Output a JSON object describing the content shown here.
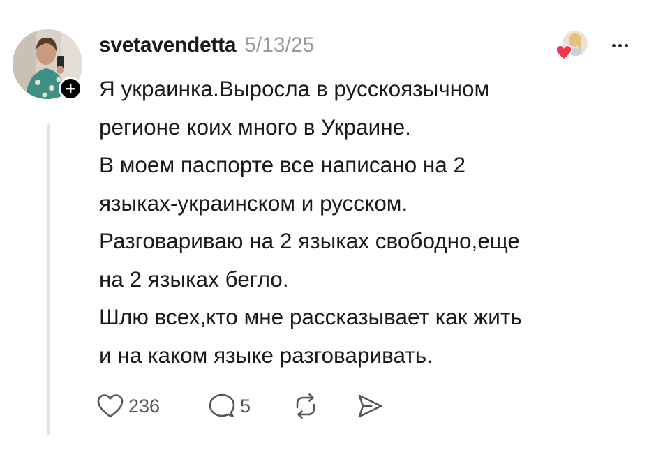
{
  "post": {
    "username": "svetavendetta",
    "timestamp": "5/13/25",
    "body_lines": [
      "Я украинка.Выросла в русскоязычном",
      "регионе коих много в Украине.",
      "В моем паспорте все написано на 2",
      "языках-украинском и русском.",
      "Разговариваю на 2 языках свободно,еще",
      "на 2 языках бегло.",
      "Шлю всех,кто мне рассказывает как жить",
      "и на каком языке разговаривать."
    ],
    "likes_count": "236",
    "comments_count": "5"
  },
  "icons": {
    "follow": "plus-icon",
    "liker_heart": "heart-filled-icon",
    "more": "more-horizontal-icon",
    "like": "heart-outline-icon",
    "comment": "comment-bubble-icon",
    "repost": "repost-arrows-icon",
    "share": "send-icon"
  },
  "colors": {
    "text": "#1a1a1a",
    "muted": "#9a9a9a",
    "icon": "#555555",
    "heart_red": "#f0384f",
    "thread_line": "#e2e2e2"
  }
}
